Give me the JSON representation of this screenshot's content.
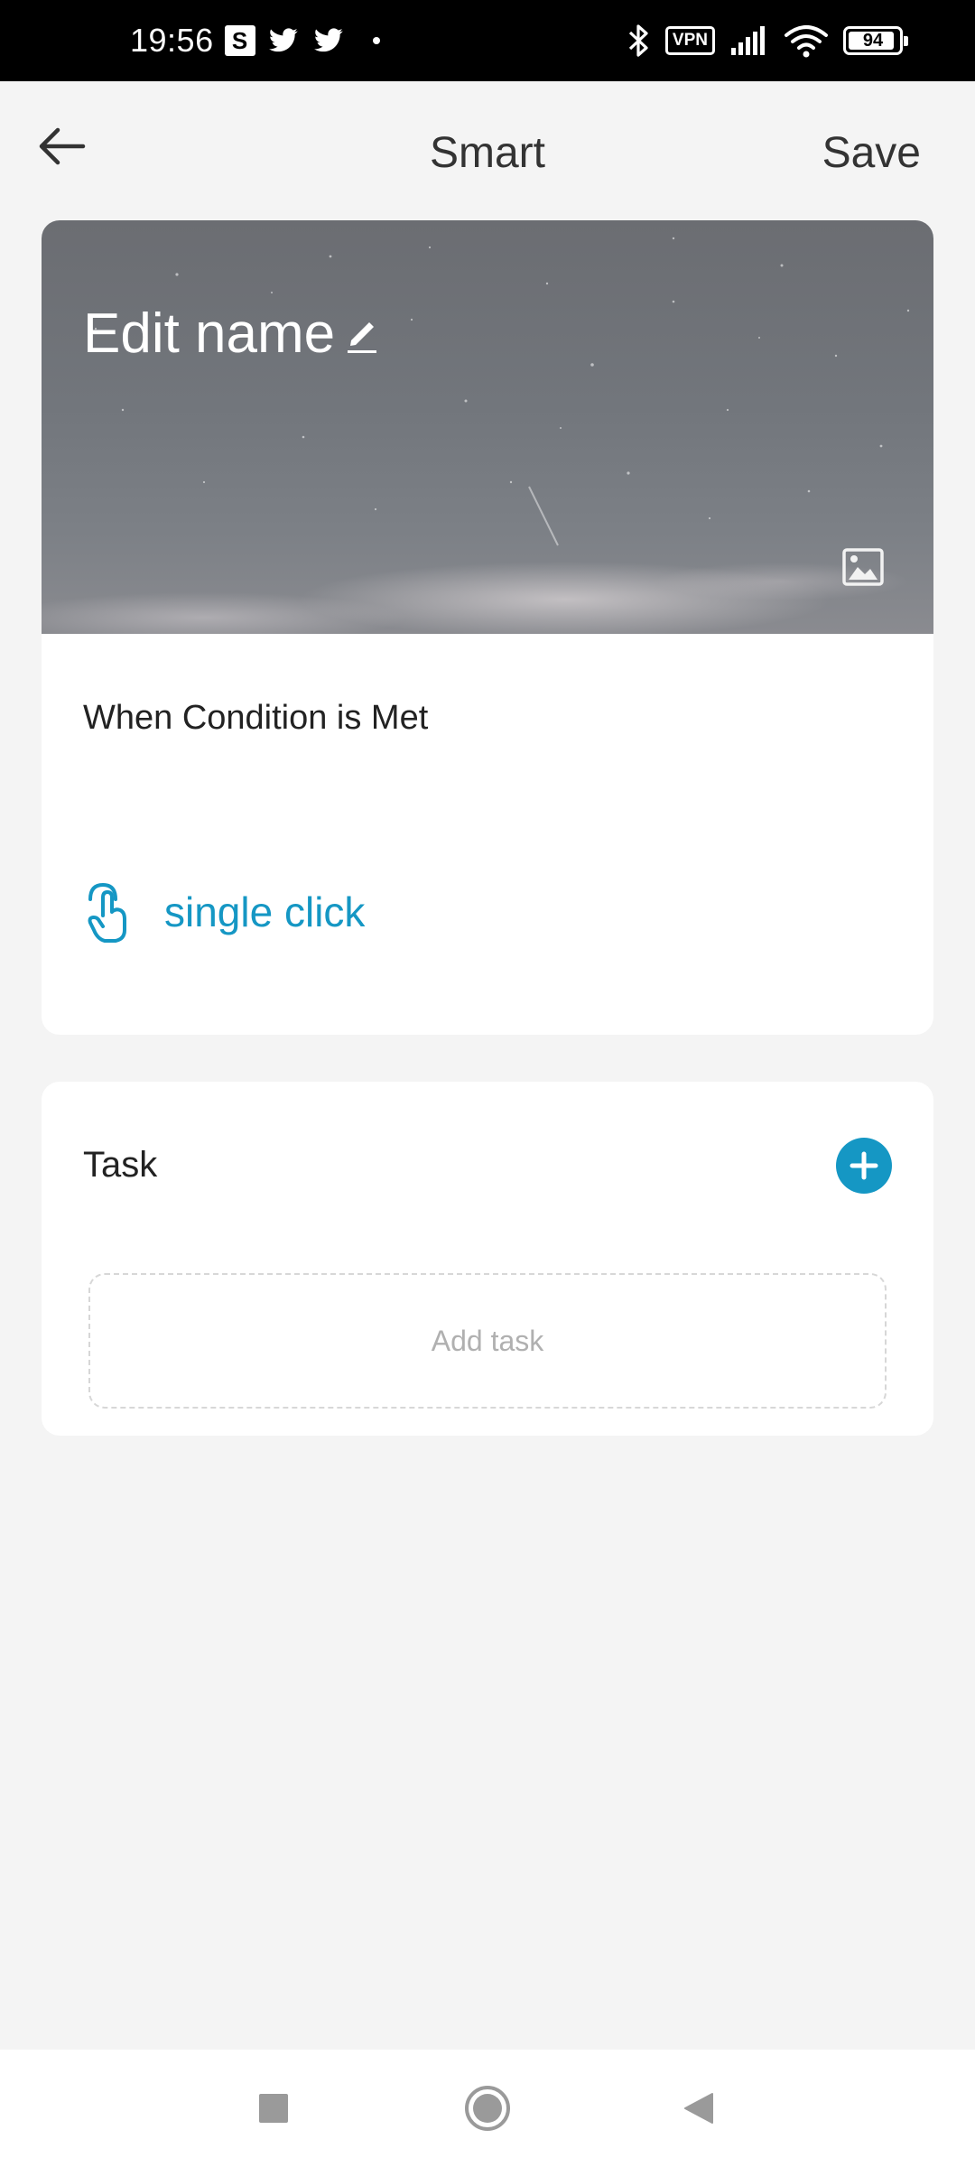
{
  "status_bar": {
    "time": "19:56",
    "s_badge": "S",
    "vpn": "VPN",
    "battery": "94",
    "icons": [
      "s-badge-icon",
      "twitter-icon",
      "twitter-icon",
      "notification-dot-icon",
      "bluetooth-icon",
      "vpn-icon",
      "signal-icon",
      "wifi-icon",
      "battery-icon"
    ]
  },
  "header": {
    "title": "Smart",
    "save_label": "Save",
    "back_icon": "arrow-left-icon"
  },
  "hero": {
    "name": "Edit name",
    "edit_icon": "pencil-icon",
    "image_icon": "image-icon"
  },
  "condition": {
    "label": "When Condition is Met",
    "trigger": {
      "icon": "hand-tap-icon",
      "text": "single click"
    }
  },
  "task": {
    "label": "Task",
    "add_icon": "plus-circle-icon",
    "placeholder": "Add task"
  },
  "nav_bar": {
    "icons": [
      "recents-square-icon",
      "home-circle-icon",
      "back-triangle-icon"
    ]
  },
  "colors": {
    "accent": "#1597c4",
    "background": "#f4f4f4",
    "card": "#ffffff",
    "status_bar": "#000000"
  }
}
